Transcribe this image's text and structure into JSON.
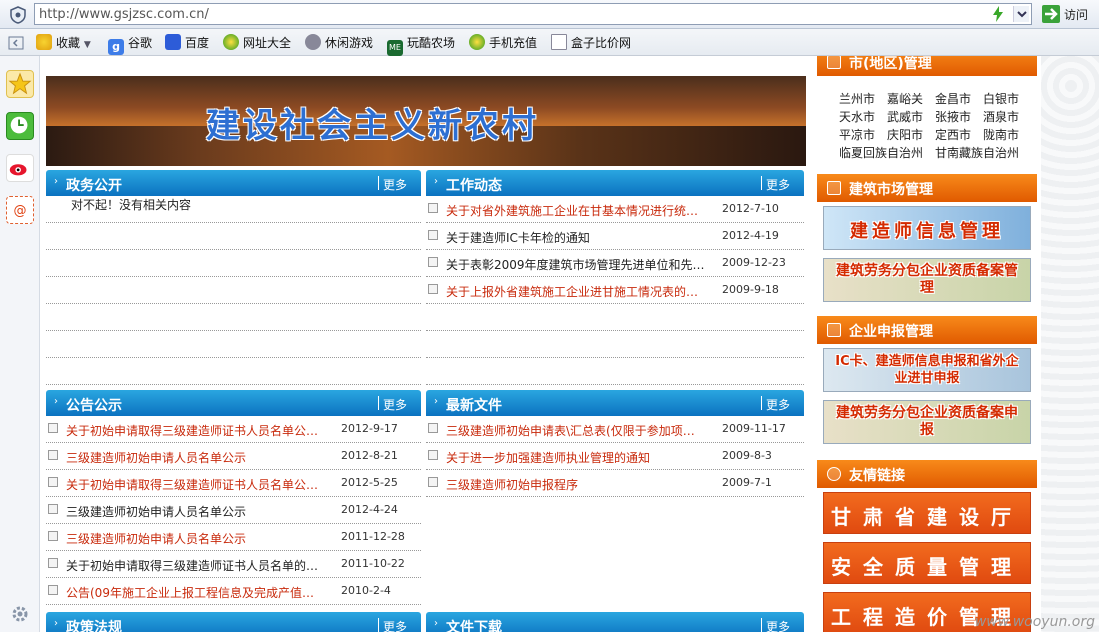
{
  "browser": {
    "url": "http://www.gsjzsc.com.cn/",
    "go_label": "访问"
  },
  "favorites": [
    {
      "label": "收藏"
    },
    {
      "label": "谷歌"
    },
    {
      "label": "百度"
    },
    {
      "label": "网址大全"
    },
    {
      "label": "休闲游戏"
    },
    {
      "label": "玩酷农场"
    },
    {
      "label": "手机充值"
    },
    {
      "label": "盒子比价网"
    }
  ],
  "banner": {
    "title": "建设社会主义新农村"
  },
  "panels": {
    "zwgk": {
      "title": "政务公开",
      "more": "更多",
      "empty": "对不起！没有相关内容"
    },
    "gzdt": {
      "title": "工作动态",
      "more": "更多",
      "items": [
        {
          "text": "关于对省外建筑施工企业在甘基本情况进行统…",
          "date": "2012-7-10",
          "red": true
        },
        {
          "text": "关于建造师IC卡年检的通知",
          "date": "2012-4-19",
          "red": false
        },
        {
          "text": "关于表彰2009年度建筑市场管理先进单位和先…",
          "date": "2009-12-23",
          "red": false
        },
        {
          "text": "关于上报外省建筑施工企业进甘施工情况表的…",
          "date": "2009-9-18",
          "red": true
        }
      ]
    },
    "gggs": {
      "title": "公告公示",
      "more": "更多",
      "items": [
        {
          "text": "关于初始申请取得三级建造师证书人员名单公…",
          "date": "2012-9-17",
          "red": true
        },
        {
          "text": "三级建造师初始申请人员名单公示",
          "date": "2012-8-21",
          "red": true
        },
        {
          "text": "关于初始申请取得三级建造师证书人员名单公…",
          "date": "2012-5-25",
          "red": true
        },
        {
          "text": "三级建造师初始申请人员名单公示",
          "date": "2012-4-24",
          "red": false
        },
        {
          "text": "三级建造师初始申请人员名单公示",
          "date": "2011-12-28",
          "red": true
        },
        {
          "text": "关于初始申请取得三级建造师证书人员名单的…",
          "date": "2011-10-22",
          "red": false
        },
        {
          "text": "公告(09年施工企业上报工程信息及完成产值…",
          "date": "2010-2-4",
          "red": true
        }
      ]
    },
    "zxwj": {
      "title": "最新文件",
      "more": "更多",
      "items": [
        {
          "text": "三级建造师初始申请表\\汇总表(仅限于参加项…",
          "date": "2009-11-17",
          "red": true
        },
        {
          "text": "关于进一步加强建造师执业管理的通知",
          "date": "2009-8-3",
          "red": true
        },
        {
          "text": "三级建造师初始申报程序",
          "date": "2009-7-1",
          "red": true
        }
      ]
    },
    "zcfg": {
      "title": "政策法规",
      "more": "更多"
    },
    "wjxz": {
      "title": "文件下载",
      "more": "更多"
    }
  },
  "right": {
    "city_head": "市(地区)管理",
    "cities": [
      [
        "兰州市",
        "嘉峪关",
        "金昌市",
        "白银市"
      ],
      [
        "天水市",
        "武威市",
        "张掖市",
        "酒泉市"
      ],
      [
        "平凉市",
        "庆阳市",
        "定西市",
        "陇南市"
      ],
      [
        "临夏回族自治州",
        "甘南藏族自治州"
      ]
    ],
    "market_head": "建筑市场管理",
    "market_btns": [
      "建造师信息管理",
      "建筑劳务分包企业资质备案管理"
    ],
    "report_head": "企业申报管理",
    "report_btns": [
      "IC卡、建造师信息申报和省外企业进甘申报",
      "建筑劳务分包企业资质备案申报"
    ],
    "links_head": "友情链接",
    "links": [
      "甘肃省建设厅",
      "安全质量管理",
      "工程造价管理"
    ]
  },
  "watermark": "www.wooyun.org"
}
